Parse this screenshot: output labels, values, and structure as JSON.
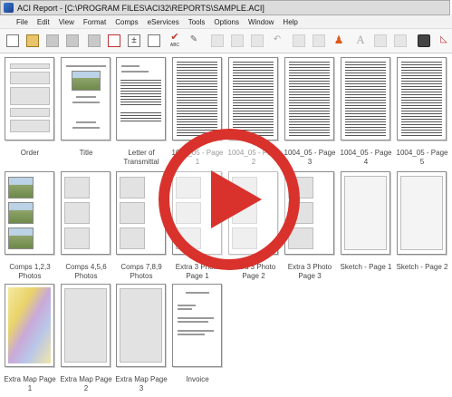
{
  "window": {
    "title": "ACI Report - [C:\\PROGRAM FILES\\ACI32\\REPORTS\\SAMPLE.ACI]"
  },
  "menu": [
    "File",
    "Edit",
    "View",
    "Format",
    "Comps",
    "eServices",
    "Tools",
    "Options",
    "Window",
    "Help"
  ],
  "toolbar": {
    "buttons": [
      "new-icon",
      "open-icon",
      "forms-icon",
      "save-icon",
      "print-icon",
      "pdf-icon",
      "calculator-icon",
      "export-icon",
      "spellcheck-icon",
      "signature-icon",
      "cut-icon",
      "copy-icon",
      "paste-icon",
      "undo-icon",
      "page-icon",
      "page-alt-icon",
      "run-icon",
      "font-icon",
      "box-icon",
      "box-alt-icon",
      "camera-icon",
      "sketch-icon"
    ],
    "spell_label": "ABC"
  },
  "pages": [
    {
      "label": "Order"
    },
    {
      "label": "Title"
    },
    {
      "label": "Letter of Transmittal"
    },
    {
      "label": "1004_05 - Page 1"
    },
    {
      "label": "1004_05 - Page 2"
    },
    {
      "label": "1004_05 - Page 3"
    },
    {
      "label": "1004_05 - Page 4"
    },
    {
      "label": "1004_05 - Page 5"
    },
    {
      "label": "Comps 1,2,3 Photos"
    },
    {
      "label": "Comps 4,5,6 Photos"
    },
    {
      "label": "Comps 7,8,9 Photos"
    },
    {
      "label": "Extra 3 Photo Page 1"
    },
    {
      "label": "Extra 3 Photo Page 2"
    },
    {
      "label": "Extra 3 Photo Page 3"
    },
    {
      "label": "Sketch - Page 1"
    },
    {
      "label": "Sketch - Page 2"
    },
    {
      "label": "Extra Map Page 1"
    },
    {
      "label": "Extra Map Page 2"
    },
    {
      "label": "Extra Map Page 3"
    },
    {
      "label": "Invoice"
    }
  ],
  "overlay": {
    "icon": "play-icon",
    "color": "#d9322c"
  }
}
